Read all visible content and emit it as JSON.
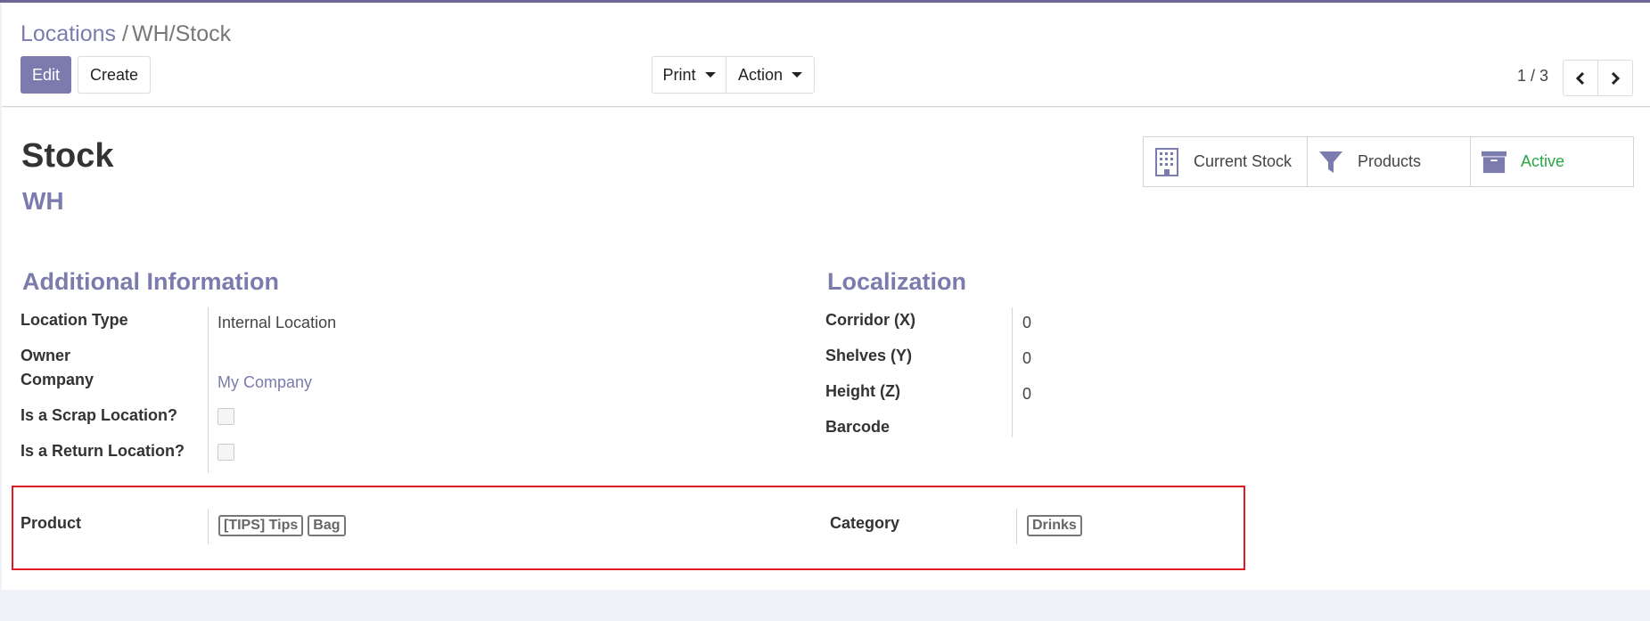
{
  "breadcrumb": {
    "parent": "Locations",
    "separator": "/",
    "current": "WH/Stock"
  },
  "toolbar": {
    "edit_label": "Edit",
    "create_label": "Create",
    "print_label": "Print",
    "action_label": "Action"
  },
  "pager": {
    "value": "1 / 3"
  },
  "record": {
    "title": "Stock",
    "parent": "WH"
  },
  "smart_buttons": {
    "current_stock": "Current Stock",
    "products": "Products",
    "active": "Active"
  },
  "additional": {
    "section_title": "Additional Information",
    "location_type_label": "Location Type",
    "location_type_value": "Internal Location",
    "owner_label": "Owner",
    "company_label": "Company",
    "company_value": "My Company",
    "scrap_label": "Is a Scrap Location?",
    "return_label": "Is a Return Location?"
  },
  "localization": {
    "section_title": "Localization",
    "corridor_label": "Corridor (X)",
    "corridor_value": "0",
    "shelves_label": "Shelves (Y)",
    "shelves_value": "0",
    "height_label": "Height (Z)",
    "height_value": "0",
    "barcode_label": "Barcode"
  },
  "restrictions": {
    "product_label": "Product",
    "product_tags": [
      "[TIPS] Tips",
      "Bag"
    ],
    "category_label": "Category",
    "category_tags": [
      "Drinks"
    ]
  },
  "colors": {
    "accent": "#7c7bad",
    "active": "#28a745",
    "highlight": "#e31b23"
  }
}
